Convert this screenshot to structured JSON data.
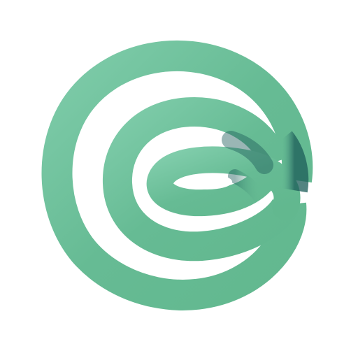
{
  "logo": {
    "name": "green-spiral-loop-logo",
    "colors": {
      "ribbon": "#66BB94",
      "ribbon_highlight": "#7FCCAA",
      "shadow": "#1E5E5A",
      "background": "#FFFFFF"
    }
  }
}
